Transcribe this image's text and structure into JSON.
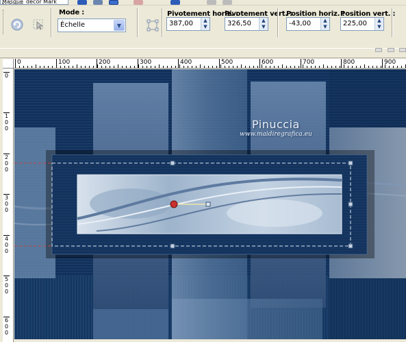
{
  "app": {
    "file_tab": "Masque_décor Mark ts.pspm"
  },
  "toolbar": {
    "mode": {
      "label": "Mode :",
      "value": "Échelle"
    },
    "pivot_horiz": {
      "label": "Pivotement horiz. :",
      "value": "387,00"
    },
    "pivot_vert": {
      "label": "Pivotement vert. :",
      "value": "326,50"
    },
    "pos_horiz": {
      "label": "Position horiz. :",
      "value": "-43,00"
    },
    "pos_vert": {
      "label": "Position vert. :",
      "value": "225,00"
    }
  },
  "ruler_h": [
    "0",
    "100",
    "200",
    "300",
    "400",
    "500",
    "600",
    "700",
    "800",
    "900"
  ],
  "ruler_v": [
    {
      "label": "0",
      "digits": [
        "0"
      ]
    },
    {
      "label": "100",
      "digits": [
        "1",
        "0",
        "0"
      ]
    },
    {
      "label": "200",
      "digits": [
        "2",
        "0",
        "0"
      ]
    },
    {
      "label": "300",
      "digits": [
        "3",
        "0",
        "0"
      ]
    },
    {
      "label": "400",
      "digits": [
        "4",
        "0",
        "0"
      ]
    },
    {
      "label": "500",
      "digits": [
        "5",
        "0",
        "0"
      ]
    },
    {
      "label": "600",
      "digits": [
        "6",
        "0",
        "0"
      ]
    }
  ],
  "watermark": {
    "title": "Pinuccia",
    "url": "www.maidiregrafica.eu"
  },
  "colors": {
    "navy": "#0f2a50",
    "steel": "#5d7fa3",
    "pale": "#c9d6e4",
    "handle": "#c9312f"
  }
}
